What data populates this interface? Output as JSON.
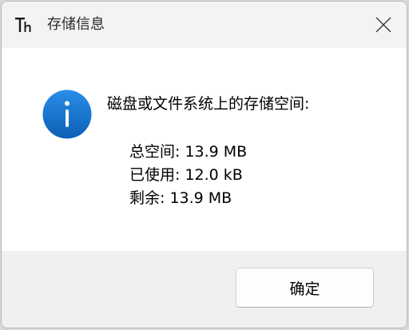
{
  "window": {
    "title": "存储信息",
    "app_icon": "typography-app-icon"
  },
  "message": {
    "icon": "information-icon",
    "main_instruction": "磁盘或文件系统上的存储空间:",
    "details": [
      "总空间: 13.9 MB",
      "已使用: 12.0 kB",
      "剩余: 13.9 MB"
    ]
  },
  "buttons": {
    "ok_label": "确定",
    "close_icon": "close-icon"
  },
  "colors": {
    "titlebar": "#f3f3f3",
    "content_bg": "#ffffff",
    "footer_bg": "#f0f0f0",
    "info_icon_blue": "#0f6cbd"
  }
}
